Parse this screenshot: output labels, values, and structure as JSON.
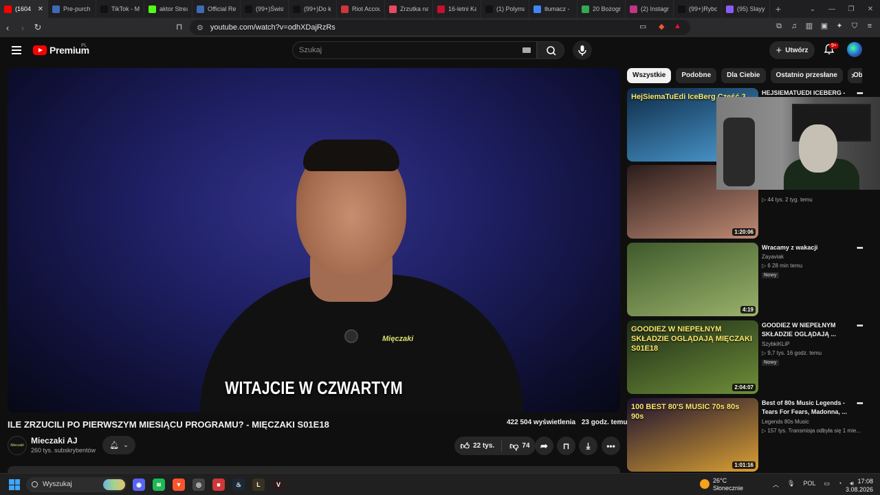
{
  "browser": {
    "tabs": [
      {
        "label": "(1604",
        "color": "#ff0000",
        "icon": "youtube-icon",
        "active": true
      },
      {
        "label": "Pre-purch",
        "color": "#3d6cb5",
        "icon": "steam-icon"
      },
      {
        "label": "TikTok - M",
        "color": "#111111",
        "icon": "tiktok-icon"
      },
      {
        "label": "aktor Strea",
        "color": "#53fc18",
        "icon": "kick-icon"
      },
      {
        "label": "Official Re",
        "color": "#3d6cb5",
        "icon": "steam-icon"
      },
      {
        "label": "(99+)Świst",
        "color": "#111111",
        "icon": "tiktok-icon"
      },
      {
        "label": "(99+)Do k",
        "color": "#111111",
        "icon": "tiktok-icon"
      },
      {
        "label": "Riot Accou",
        "color": "#d13639",
        "icon": "riot-icon"
      },
      {
        "label": "Zrzutka na",
        "color": "#e84a5f",
        "icon": "zrzutka-icon"
      },
      {
        "label": "16-letni Ka",
        "color": "#c8102e",
        "icon": "news-icon"
      },
      {
        "label": "(1) Polyma",
        "color": "#111111",
        "icon": "x-icon"
      },
      {
        "label": "tłumacz -",
        "color": "#4285f4",
        "icon": "google-icon"
      },
      {
        "label": "20 Bożogr",
        "color": "#34a853",
        "icon": "maps-icon"
      },
      {
        "label": "(2) Instagr",
        "color": "#c13584",
        "icon": "instagram-icon"
      },
      {
        "label": "(99+)Rybo",
        "color": "#111111",
        "icon": "tiktok-icon"
      },
      {
        "label": "(95) Slayy",
        "color": "#8a5cf6",
        "icon": "twitch-icon"
      }
    ],
    "url": "youtube.com/watch?v=odhXDajRzRs"
  },
  "header": {
    "logo_text": "Premium",
    "region": "PL",
    "search_placeholder": "Szukaj",
    "create_label": "Utwórz",
    "notif_count": "9+"
  },
  "video": {
    "caption": "WITAJCIE W CZWARTYM",
    "shirt_text": "Mięczaki",
    "title": "ILE ZRZUCILI PO PIERWSZYM MIESIĄCU PROGRAMU? - MIĘCZAKI S01E18",
    "views": "422 504 wyświetlenia",
    "age": "23 godz. temu",
    "channel": "Mieczaki AJ",
    "subscribers": "260 tys. subskrybentów",
    "likes": "22 tys.",
    "dislikes": "74"
  },
  "chips": [
    "Wszystkie",
    "Podobne",
    "Dla Ciebie",
    "Ostatnio przesłane",
    "Obe"
  ],
  "recommendations": [
    {
      "title": "HEJSIEMATUEDI ICEBERG -",
      "channel": "",
      "stats": "",
      "duration": "",
      "new": "",
      "thumb": [
        "#0e2a46",
        "#4d9fd6"
      ],
      "thumb_text": "HejSiemaTuEdi IceBerg Część 3"
    },
    {
      "title": "",
      "channel": "",
      "stats": "▷ 44 tys.   2 tyg. temu",
      "duration": "1:20:06",
      "new": "",
      "thumb": [
        "#2a1c1a",
        "#c08a74"
      ],
      "thumb_text": ""
    },
    {
      "title": "Wracamy z wakacji",
      "channel": "Zayaviak",
      "stats": "▷ 6   28 min temu",
      "duration": "4:19",
      "new": "Nowy",
      "thumb": [
        "#3e5a2b",
        "#9bb26b"
      ],
      "thumb_text": ""
    },
    {
      "title": "GOODIEZ W NIEPEŁNYM SKŁADZIE OGLĄDAJĄ ...",
      "channel": "SzybkiKLiP",
      "stats": "▷ 9,7 tys.   16 godz. temu",
      "duration": "2:04:07",
      "new": "Nowy",
      "thumb": [
        "#1d2b18",
        "#6f8f38"
      ],
      "thumb_text": "GOODIEZ W NIEPEŁNYM SKŁADZIE OGLĄDAJĄ MIĘCZAKI S01E18"
    },
    {
      "title": "Best of 80s Music Legends - Tears For Fears, Madonna, ...",
      "channel": "Legends 80s Music",
      "stats": "▷ 157 tys.   Transmisja odbyła się 1 mie...",
      "duration": "1:01:16",
      "new": "",
      "thumb": [
        "#1a1030",
        "#d9a032"
      ],
      "thumb_text": "100 BEST 80'S MUSIC 70s 80s 90s"
    }
  ],
  "taskbar": {
    "search": "Wyszukaj",
    "temperature": "26°C",
    "weather": "Słonecznie",
    "lang": "POL",
    "time": "17:08",
    "date": "3.08.2026",
    "apps": [
      {
        "name": "discord-app-icon",
        "color": "#5865f2",
        "glyph": "◉"
      },
      {
        "name": "spotify-app-icon",
        "color": "#1db954",
        "glyph": "≋"
      },
      {
        "name": "brave-app-icon",
        "color": "#fb542b",
        "glyph": "▼"
      },
      {
        "name": "chrome-app-icon",
        "color": "#444444",
        "glyph": "◎"
      },
      {
        "name": "riot-app-icon",
        "color": "#d13639",
        "glyph": "■"
      },
      {
        "name": "steam-app-icon",
        "color": "#1b2838",
        "glyph": "♨"
      },
      {
        "name": "lol-app-icon",
        "color": "#3a3220",
        "glyph": "L"
      },
      {
        "name": "valorant-app-icon",
        "color": "#2a1c1c",
        "glyph": "V"
      }
    ]
  }
}
